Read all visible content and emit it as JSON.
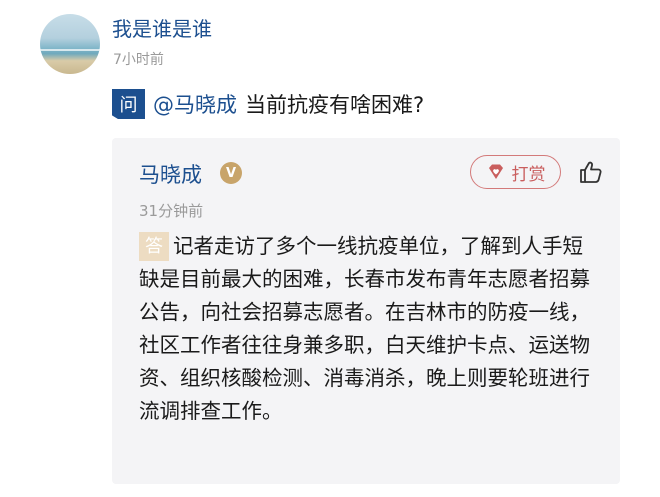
{
  "post": {
    "username": "我是谁是谁",
    "time": "7小时前"
  },
  "question": {
    "badge": "问",
    "mention": "@马晓成",
    "text": "当前抗疫有啥困难?"
  },
  "answer": {
    "name": "马晓成",
    "verified_badge": "V",
    "tip_label": "打赏",
    "time": "31分钟前",
    "badge": "答",
    "text": "记者走访了多个一线抗疫单位，了解到人手短缺是目前最大的困难，长春市发布青年志愿者招募公告，向社会招募志愿者。在吉林市的防疫一线，社区工作者往往身兼多职，白天维护卡点、运送物资、组织核酸检测、消毒消杀，晚上则要轮班进行流调排查工作。"
  },
  "colors": {
    "link_blue": "#1c4f8f",
    "tip_red": "#c95e5e",
    "answer_badge": "#eddcc2",
    "verified_gold": "#c8a46a",
    "card_bg": "#f4f4f6"
  },
  "icons": {
    "avatar": "beach-horizon-avatar",
    "tip": "diamond-heart-icon",
    "like": "thumbs-up-icon"
  }
}
